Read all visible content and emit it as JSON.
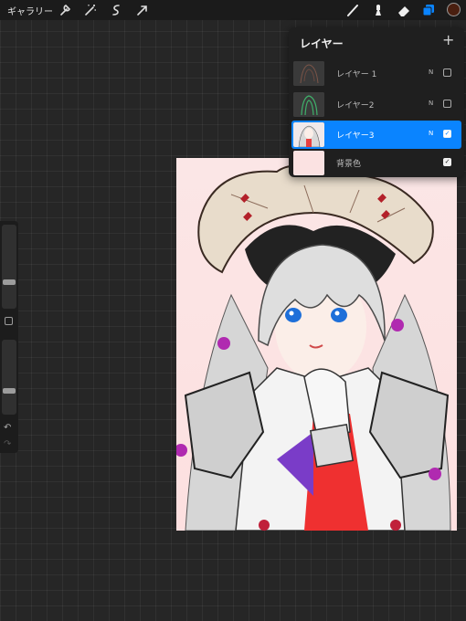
{
  "topbar": {
    "gallery_label": "ギャラリー",
    "left_tools": [
      "wrench-icon",
      "magic-wand-icon",
      "selection-icon",
      "transform-arrow-icon"
    ],
    "right_tools": [
      "brush-icon",
      "smudge-icon",
      "eraser-icon",
      "layers-icon"
    ],
    "current_color": "#4a1f10",
    "accent_color": "#0a84ff"
  },
  "sidebar": {
    "brush_size_level": 0.3,
    "opacity_level": 0.3,
    "undo_icon": "undo-icon",
    "redo_icon": "redo-icon"
  },
  "layers_panel": {
    "title": "レイヤー",
    "add_icon": "+",
    "layers": [
      {
        "name": "レイヤー 1",
        "blend": "N",
        "visible": false,
        "active": false
      },
      {
        "name": "レイヤー2",
        "blend": "N",
        "visible": false,
        "active": false
      },
      {
        "name": "レイヤー3",
        "blend": "N",
        "visible": true,
        "active": true
      },
      {
        "name": "背景色",
        "blend": "",
        "visible": true,
        "active": false
      }
    ]
  },
  "canvas": {
    "background_color": "#fde4e4",
    "subject": "anime-character-illustration"
  }
}
